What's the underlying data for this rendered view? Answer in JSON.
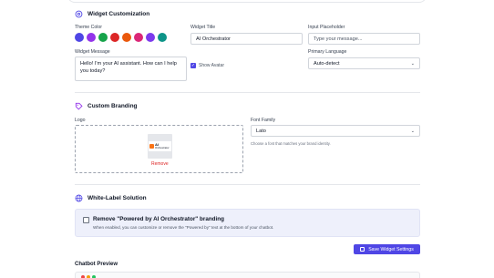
{
  "widget_customization": {
    "title": "Widget Customization",
    "theme_color_label": "Theme Color",
    "theme_colors": [
      "#4f46e5",
      "#9333ea",
      "#16a34a",
      "#dc2626",
      "#ea580c",
      "#db2777",
      "#7c3aed",
      "#0d9488"
    ],
    "widget_title_label": "Widget Title",
    "widget_title_value": "AI Orchestrator",
    "input_placeholder_label": "Input Placeholder",
    "input_placeholder_value": "Type your message...",
    "widget_message_label": "Widget Message",
    "widget_message_value": "Hello! I'm your AI assistant. How can I help you today?",
    "show_avatar_label": "Show Avatar",
    "show_avatar_checked": true,
    "primary_language_label": "Primary Language",
    "primary_language_value": "Auto-detect"
  },
  "custom_branding": {
    "title": "Custom Branding",
    "logo_label": "Logo",
    "logo_text_main": "AI",
    "logo_text_sub": "Orchestrator",
    "remove_label": "Remove",
    "font_family_label": "Font Family",
    "font_family_value": "Lato",
    "font_hint": "Choose a font that matches your brand identity."
  },
  "white_label": {
    "title": "White-Label Solution",
    "option_title": "Remove \"Powered by AI Orchestrator\" branding",
    "option_desc": "When enabled, you can customize or remove the \"Powered by\" text at the bottom of your chatbot."
  },
  "actions": {
    "save_label": "Save Widget Settings"
  },
  "preview": {
    "title": "Chatbot Preview",
    "dot_colors": [
      "#ef4444",
      "#f59e0b",
      "#22c55e"
    ]
  },
  "accent": "#4f46e5"
}
